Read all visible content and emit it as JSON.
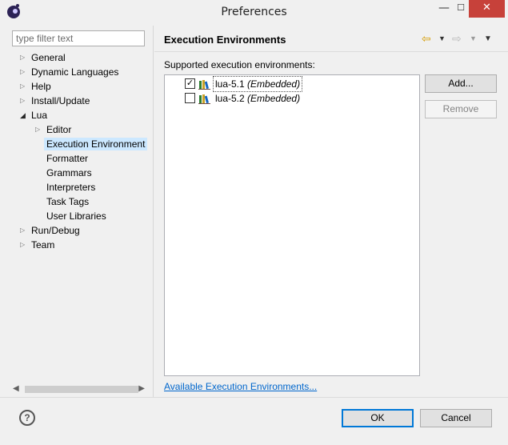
{
  "window": {
    "title": "Preferences",
    "min_glyph": "—",
    "max_glyph": "☐",
    "close_glyph": "✕"
  },
  "filter": {
    "placeholder": "type filter text",
    "value": ""
  },
  "tree": {
    "items": [
      {
        "label": "General",
        "level": 0,
        "state": "collapsed"
      },
      {
        "label": "Dynamic Languages",
        "level": 0,
        "state": "collapsed"
      },
      {
        "label": "Help",
        "level": 0,
        "state": "collapsed"
      },
      {
        "label": "Install/Update",
        "level": 0,
        "state": "collapsed"
      },
      {
        "label": "Lua",
        "level": 0,
        "state": "expanded"
      },
      {
        "label": "Editor",
        "level": 1,
        "state": "collapsed"
      },
      {
        "label": "Execution Environment",
        "level": 1,
        "state": "leaf",
        "selected": true
      },
      {
        "label": "Formatter",
        "level": 1,
        "state": "leaf"
      },
      {
        "label": "Grammars",
        "level": 1,
        "state": "leaf"
      },
      {
        "label": "Interpreters",
        "level": 1,
        "state": "leaf"
      },
      {
        "label": "Task Tags",
        "level": 1,
        "state": "leaf"
      },
      {
        "label": "User Libraries",
        "level": 1,
        "state": "leaf"
      },
      {
        "label": "Run/Debug",
        "level": 0,
        "state": "collapsed"
      },
      {
        "label": "Team",
        "level": 0,
        "state": "collapsed"
      }
    ],
    "arrow_collapsed": "▷",
    "arrow_expanded": "◢"
  },
  "page": {
    "title": "Execution Environments",
    "section_label": "Supported execution environments:",
    "link_text": "Available Execution Environments..."
  },
  "nav": {
    "back_icon": "arrow-left-icon",
    "forward_icon": "arrow-right-icon",
    "back_glyph": "⇦",
    "forward_glyph": "⇨",
    "dropdown_glyph": "▼"
  },
  "environments": [
    {
      "name": "lua-5.1",
      "tag": "(Embedded)",
      "checked": true
    },
    {
      "name": "lua-5.2",
      "tag": "(Embedded)",
      "checked": false
    }
  ],
  "buttons": {
    "add": "Add...",
    "remove": "Remove",
    "ok": "OK",
    "cancel": "Cancel",
    "help_glyph": "?"
  },
  "colors": {
    "selection": "#cce8ff",
    "link": "#0066cc",
    "close_button": "#c7413a"
  }
}
